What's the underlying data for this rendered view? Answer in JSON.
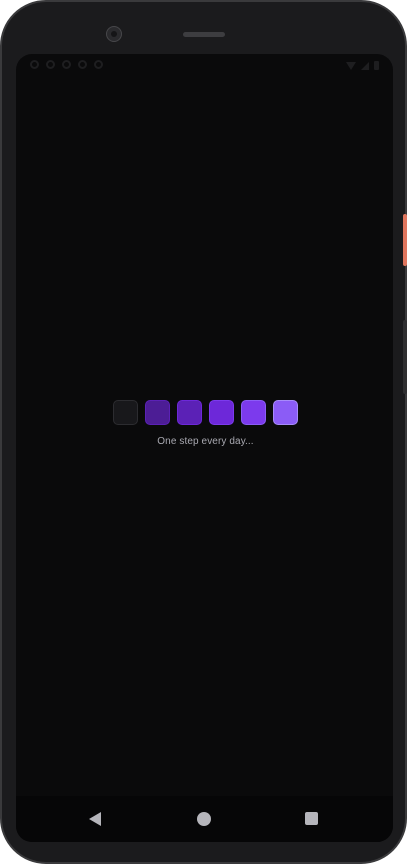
{
  "loader": {
    "caption": "One step every day...",
    "squares": [
      {
        "color": "#18181b",
        "border": "#2c2c30",
        "name": "step-square-1"
      },
      {
        "color": "#4c1d95",
        "border": "#5b21b6",
        "name": "step-square-2"
      },
      {
        "color": "#5b21b6",
        "border": "#6d28d9",
        "name": "step-square-3"
      },
      {
        "color": "#6d28d9",
        "border": "#7c3aed",
        "name": "step-square-4"
      },
      {
        "color": "#7c3aed",
        "border": "#8b5cf6",
        "name": "step-square-5"
      },
      {
        "color": "#8b5cf6",
        "border": "#a78bfa",
        "name": "step-square-6"
      }
    ]
  },
  "nav": {
    "back_icon": "back-triangle-icon",
    "home_icon": "home-circle-icon",
    "recents_icon": "recents-square-icon"
  },
  "colors": {
    "screen_background": "#0a0a0b",
    "accent": "#8b5cf6",
    "caption_text": "#a9a9b1"
  }
}
